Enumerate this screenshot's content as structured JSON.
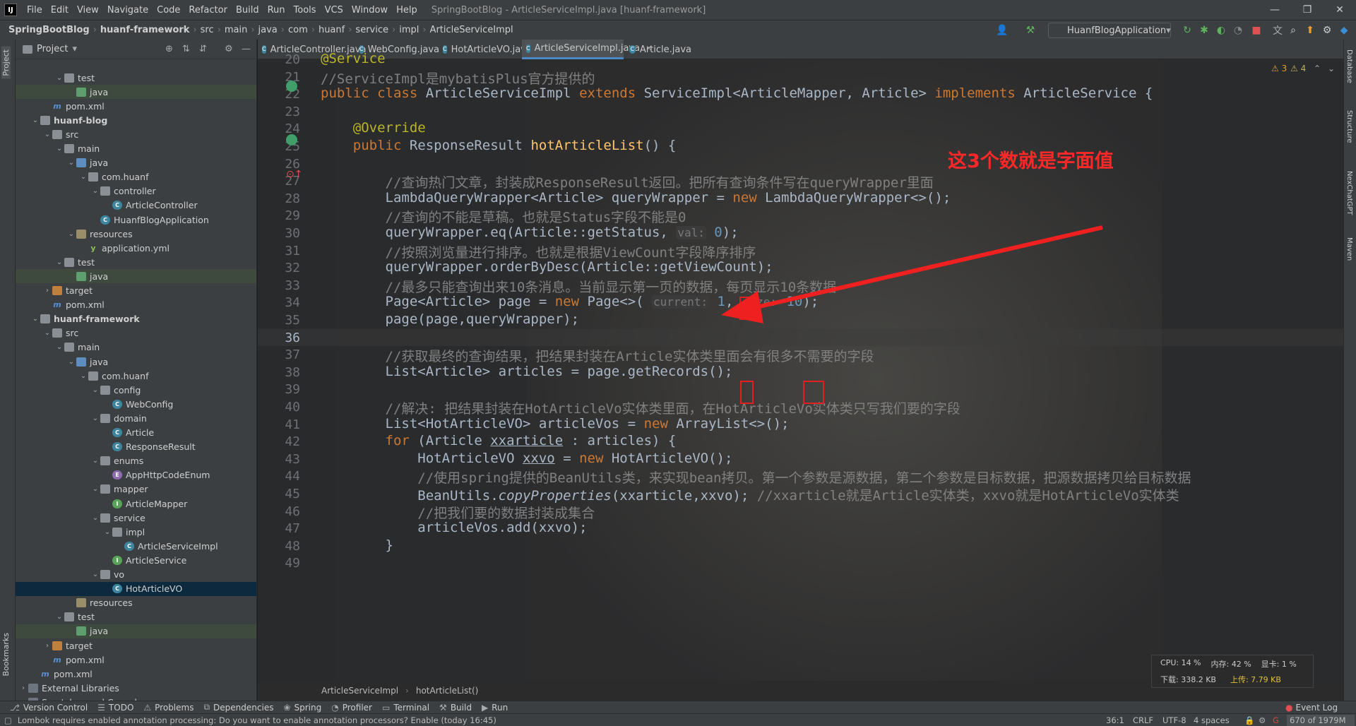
{
  "menubar": {
    "logo": "IJ",
    "items": [
      "File",
      "Edit",
      "View",
      "Navigate",
      "Code",
      "Refactor",
      "Build",
      "Run",
      "Tools",
      "VCS",
      "Window",
      "Help"
    ],
    "title": "SpringBootBlog - ArticleServiceImpl.java [huanf-framework]"
  },
  "navbar": {
    "crumbs": [
      "SpringBootBlog",
      "huanf-framework",
      "src",
      "main",
      "java",
      "com",
      "huanf",
      "service",
      "impl",
      "ArticleServiceImpl"
    ],
    "run_config": "HuanfBlogApplication"
  },
  "sidebar": {
    "title": "Project",
    "left_tabs": [
      "Project",
      "Bookmarks"
    ]
  },
  "tree": [
    {
      "label": "test",
      "type": "folder",
      "indent": 3,
      "arrow": "v"
    },
    {
      "label": "java",
      "type": "test",
      "indent": 4,
      "arrow": "",
      "hl": true
    },
    {
      "label": "pom.xml",
      "type": "pom",
      "indent": 2,
      "arrow": ""
    },
    {
      "label": "huanf-blog",
      "type": "folder",
      "indent": 1,
      "arrow": "v",
      "bold": true
    },
    {
      "label": "src",
      "type": "folder",
      "indent": 2,
      "arrow": "v"
    },
    {
      "label": "main",
      "type": "folder",
      "indent": 3,
      "arrow": "v"
    },
    {
      "label": "java",
      "type": "src",
      "indent": 4,
      "arrow": "v"
    },
    {
      "label": "com.huanf",
      "type": "folder",
      "indent": 5,
      "arrow": "v"
    },
    {
      "label": "controller",
      "type": "folder",
      "indent": 6,
      "arrow": "v"
    },
    {
      "label": "ArticleController",
      "type": "cls",
      "indent": 7,
      "arrow": ""
    },
    {
      "label": "HuanfBlogApplication",
      "type": "cls",
      "indent": 6,
      "arrow": ""
    },
    {
      "label": "resources",
      "type": "res",
      "indent": 4,
      "arrow": "v"
    },
    {
      "label": "application.yml",
      "type": "yml",
      "indent": 5,
      "arrow": ""
    },
    {
      "label": "test",
      "type": "folder",
      "indent": 3,
      "arrow": "v"
    },
    {
      "label": "java",
      "type": "test",
      "indent": 4,
      "arrow": "",
      "hl": true
    },
    {
      "label": "target",
      "type": "target",
      "indent": 2,
      "arrow": ">"
    },
    {
      "label": "pom.xml",
      "type": "pom",
      "indent": 2,
      "arrow": ""
    },
    {
      "label": "huanf-framework",
      "type": "folder",
      "indent": 1,
      "arrow": "v",
      "bold": true
    },
    {
      "label": "src",
      "type": "folder",
      "indent": 2,
      "arrow": "v"
    },
    {
      "label": "main",
      "type": "folder",
      "indent": 3,
      "arrow": "v"
    },
    {
      "label": "java",
      "type": "src",
      "indent": 4,
      "arrow": "v"
    },
    {
      "label": "com.huanf",
      "type": "folder",
      "indent": 5,
      "arrow": "v"
    },
    {
      "label": "config",
      "type": "folder",
      "indent": 6,
      "arrow": "v"
    },
    {
      "label": "WebConfig",
      "type": "cls",
      "indent": 7,
      "arrow": ""
    },
    {
      "label": "domain",
      "type": "folder",
      "indent": 6,
      "arrow": "v"
    },
    {
      "label": "Article",
      "type": "cls",
      "indent": 7,
      "arrow": ""
    },
    {
      "label": "ResponseResult",
      "type": "cls",
      "indent": 7,
      "arrow": ""
    },
    {
      "label": "enums",
      "type": "folder",
      "indent": 6,
      "arrow": "v"
    },
    {
      "label": "AppHttpCodeEnum",
      "type": "enm",
      "indent": 7,
      "arrow": ""
    },
    {
      "label": "mapper",
      "type": "folder",
      "indent": 6,
      "arrow": "v"
    },
    {
      "label": "ArticleMapper",
      "type": "intf",
      "indent": 7,
      "arrow": ""
    },
    {
      "label": "service",
      "type": "folder",
      "indent": 6,
      "arrow": "v"
    },
    {
      "label": "impl",
      "type": "folder",
      "indent": 7,
      "arrow": "v"
    },
    {
      "label": "ArticleServiceImpl",
      "type": "cls",
      "indent": 8,
      "arrow": ""
    },
    {
      "label": "ArticleService",
      "type": "intf",
      "indent": 7,
      "arrow": ""
    },
    {
      "label": "vo",
      "type": "folder",
      "indent": 6,
      "arrow": "v"
    },
    {
      "label": "HotArticleVO",
      "type": "cls",
      "indent": 7,
      "arrow": "",
      "sel": true
    },
    {
      "label": "resources",
      "type": "res",
      "indent": 4,
      "arrow": ""
    },
    {
      "label": "test",
      "type": "folder",
      "indent": 3,
      "arrow": "v"
    },
    {
      "label": "java",
      "type": "test",
      "indent": 4,
      "arrow": "",
      "hl": true
    },
    {
      "label": "target",
      "type": "target",
      "indent": 2,
      "arrow": ">"
    },
    {
      "label": "pom.xml",
      "type": "pom",
      "indent": 2,
      "arrow": ""
    },
    {
      "label": "pom.xml",
      "type": "pom",
      "indent": 1,
      "arrow": ""
    },
    {
      "label": "External Libraries",
      "type": "lib",
      "indent": 0,
      "arrow": ">"
    },
    {
      "label": "Scratches and Consoles",
      "type": "lib",
      "indent": 0,
      "arrow": ">"
    }
  ],
  "tabs": [
    {
      "label": "ArticleController.java",
      "active": false
    },
    {
      "label": "WebConfig.java",
      "active": false
    },
    {
      "label": "HotArticleVO.java",
      "active": false
    },
    {
      "label": "ArticleServiceImpl.java",
      "active": true
    },
    {
      "label": "Article.java",
      "active": false
    }
  ],
  "inspections": {
    "warnings": "3",
    "weak": "4"
  },
  "code": [
    {
      "n": "20",
      "segs": [
        {
          "t": "@Service",
          "c": "an"
        }
      ]
    },
    {
      "n": "21",
      "segs": [
        {
          "t": "//ServiceImpl是mybatisPlus官方提供的",
          "c": "cm"
        }
      ]
    },
    {
      "n": "22",
      "segs": [
        {
          "t": "public class ",
          "c": "kw"
        },
        {
          "t": "ArticleServiceImpl "
        },
        {
          "t": "extends ",
          "c": "kw"
        },
        {
          "t": "ServiceImpl<ArticleMapper, Article> "
        },
        {
          "t": "implements ",
          "c": "kw"
        },
        {
          "t": "ArticleService {"
        }
      ]
    },
    {
      "n": "23",
      "segs": []
    },
    {
      "n": "24",
      "segs": [
        {
          "t": "    "
        },
        {
          "t": "@Override",
          "c": "an"
        }
      ]
    },
    {
      "n": "25",
      "segs": [
        {
          "t": "    "
        },
        {
          "t": "public ",
          "c": "kw"
        },
        {
          "t": "ResponseResult "
        },
        {
          "t": "hotArticleList",
          "c": "fn"
        },
        {
          "t": "() {"
        }
      ]
    },
    {
      "n": "26",
      "segs": []
    },
    {
      "n": "27",
      "segs": [
        {
          "t": "        "
        },
        {
          "t": "//查询热门文章，封装成ResponseResult返回。把所有查询条件写在queryWrapper里面",
          "c": "cm"
        }
      ]
    },
    {
      "n": "28",
      "segs": [
        {
          "t": "        LambdaQueryWrapper<Article> queryWrapper = "
        },
        {
          "t": "new ",
          "c": "kw"
        },
        {
          "t": "LambdaQueryWrapper<>();"
        }
      ]
    },
    {
      "n": "29",
      "segs": [
        {
          "t": "        "
        },
        {
          "t": "//查询的不能是草稿。也就是Status字段不能是0",
          "c": "cm"
        }
      ]
    },
    {
      "n": "30",
      "segs": [
        {
          "t": "        queryWrapper.eq(Article::getStatus, "
        },
        {
          "t": "val:",
          "c": "hint"
        },
        {
          "t": " 0",
          "c": "num"
        },
        {
          "t": ");"
        }
      ]
    },
    {
      "n": "31",
      "segs": [
        {
          "t": "        "
        },
        {
          "t": "//按照浏览量进行排序。也就是根据ViewCount字段降序排序",
          "c": "cm"
        }
      ]
    },
    {
      "n": "32",
      "segs": [
        {
          "t": "        queryWrapper.orderByDesc(Article::getViewCount);"
        }
      ]
    },
    {
      "n": "33",
      "segs": [
        {
          "t": "        "
        },
        {
          "t": "//最多只能查询出来10条消息。当前显示第一页的数据，每页显示10条数据",
          "c": "cm"
        }
      ]
    },
    {
      "n": "34",
      "segs": [
        {
          "t": "        Page<Article> page = "
        },
        {
          "t": "new ",
          "c": "kw"
        },
        {
          "t": "Page<>( "
        },
        {
          "t": "current:",
          "c": "hint"
        },
        {
          "t": " 1",
          "c": "num"
        },
        {
          "t": ", "
        },
        {
          "t": "size:",
          "c": "hint"
        },
        {
          "t": " 10",
          "c": "num"
        },
        {
          "t": ");"
        }
      ]
    },
    {
      "n": "35",
      "segs": [
        {
          "t": "        page(page,queryWrapper);"
        }
      ]
    },
    {
      "n": "36",
      "segs": []
    },
    {
      "n": "37",
      "segs": [
        {
          "t": "        "
        },
        {
          "t": "//获取最终的查询结果，把结果封装在Article实体类里面会有很多不需要的字段",
          "c": "cm"
        }
      ]
    },
    {
      "n": "38",
      "segs": [
        {
          "t": "        List<Article> articles = page.getRecords();"
        }
      ]
    },
    {
      "n": "39",
      "segs": []
    },
    {
      "n": "40",
      "segs": [
        {
          "t": "        "
        },
        {
          "t": "//解决: 把结果封装在HotArticleVo实体类里面，在HotArticleVo实体类只写我们要的字段",
          "c": "cm"
        }
      ]
    },
    {
      "n": "41",
      "segs": [
        {
          "t": "        List<HotArticleVO> articleVos = "
        },
        {
          "t": "new ",
          "c": "kw"
        },
        {
          "t": "ArrayList<>();"
        }
      ]
    },
    {
      "n": "42",
      "segs": [
        {
          "t": "        "
        },
        {
          "t": "for ",
          "c": "kw"
        },
        {
          "t": "(Article "
        },
        {
          "t": "xxarticle",
          "c": "ul"
        },
        {
          "t": " : articles) {"
        }
      ]
    },
    {
      "n": "43",
      "segs": [
        {
          "t": "            HotArticleVO "
        },
        {
          "t": "xxvo",
          "c": "ul"
        },
        {
          "t": " = "
        },
        {
          "t": "new ",
          "c": "kw"
        },
        {
          "t": "HotArticleVO();"
        }
      ]
    },
    {
      "n": "44",
      "segs": [
        {
          "t": "            "
        },
        {
          "t": "//使用spring提供的BeanUtils类，来实现bean拷贝。第一个参数是源数据，第二个参数是目标数据，把源数据拷贝给目标数据",
          "c": "cm"
        }
      ]
    },
    {
      "n": "45",
      "segs": [
        {
          "t": "            BeanUtils."
        },
        {
          "t": "copyProperties",
          "c": "it"
        },
        {
          "t": "(xxarticle,xxvo); "
        },
        {
          "t": "//xxarticle就是Article实体类，xxvo就是HotArticleVo实体类",
          "c": "cm"
        }
      ]
    },
    {
      "n": "46",
      "segs": [
        {
          "t": "            "
        },
        {
          "t": "//把我们要的数据封装成集合",
          "c": "cm"
        }
      ]
    },
    {
      "n": "47",
      "segs": [
        {
          "t": "            articleVos.add(xxvo);"
        }
      ]
    },
    {
      "n": "48",
      "segs": [
        {
          "t": "        }"
        }
      ]
    },
    {
      "n": "49",
      "segs": []
    }
  ],
  "annotation": {
    "text": "这3个数就是字面值",
    "color": "#ff2828"
  },
  "breadcrumb": {
    "cls": "ArticleServiceImpl",
    "method": "hotArticleList()"
  },
  "right_tabs": [
    "Database",
    "Structure",
    "NexChatGPT",
    "Maven"
  ],
  "perf": {
    "cpu": "CPU: 14 %",
    "mem": "内存: 42 %",
    "gpu": "显卡: 1 %",
    "down": "下载: 338.2 KB",
    "up": "上传: 7.79 KB"
  },
  "toolwindows": [
    "Version Control",
    "TODO",
    "Problems",
    "Dependencies",
    "Spring",
    "Profiler",
    "Terminal",
    "Build",
    "Run"
  ],
  "event_log": "Event Log",
  "status": {
    "message": "Lombok requires enabled annotation processing: Do you want to enable annotation processors? Enable (today 16:45)",
    "pos": "36:1",
    "eol": "CRLF",
    "enc": "UTF-8",
    "indent": "4 spaces",
    "memory": "670 of 1979M"
  }
}
